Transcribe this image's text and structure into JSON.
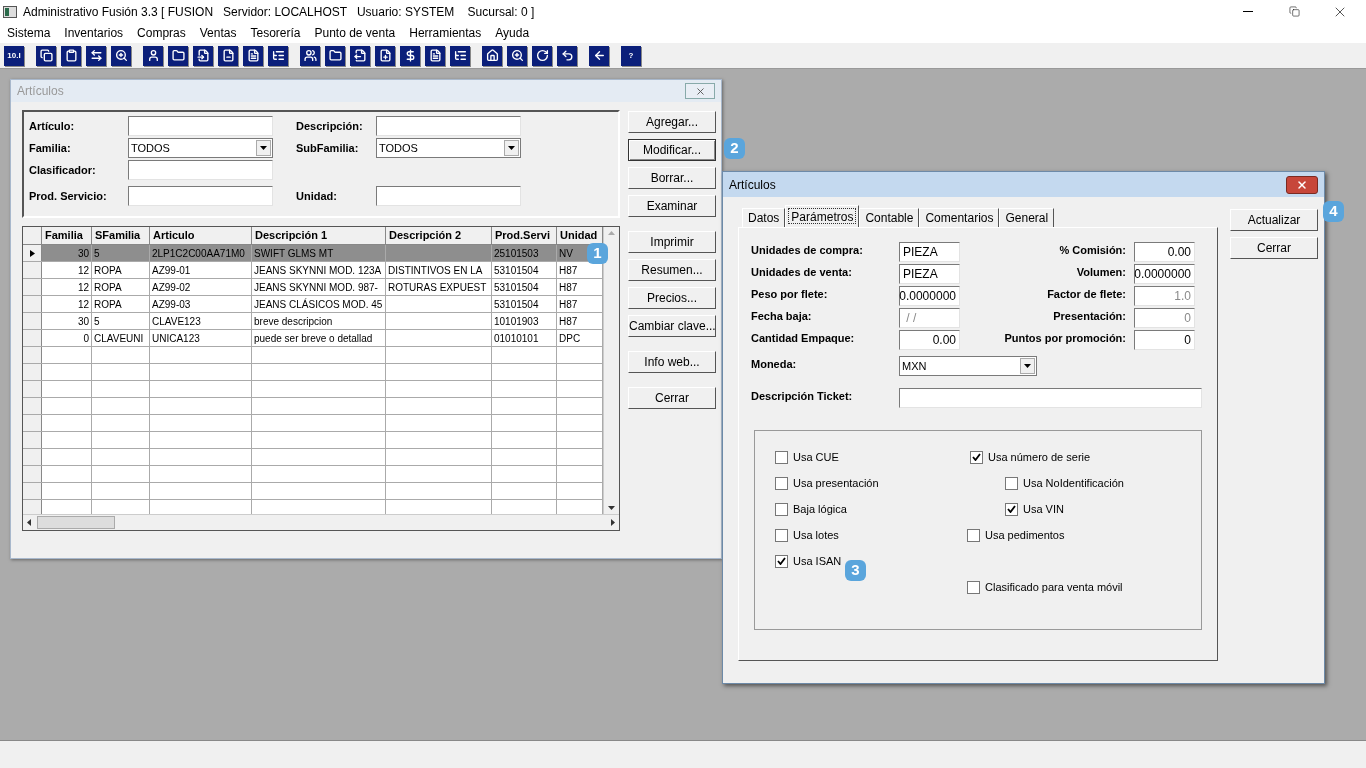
{
  "app": {
    "title": "Administrativo Fusión 3.3 [ FUSION   Servidor: LOCALHOST   Usuario: SYSTEM    Sucursal: 0 ]"
  },
  "menu": [
    "Sistema",
    "Inventarios",
    "Compras",
    "Ventas",
    "Tesorería",
    "Punto de venta",
    "Herramientas",
    "Ayuda"
  ],
  "toolbar_texts": [
    "10.I",
    "?"
  ],
  "list_window": {
    "title": "Artículos",
    "active": false,
    "filter_rows": [
      {
        "left": {
          "label": "Artículo:",
          "kind": "text"
        },
        "right": {
          "label": "Descripción:",
          "kind": "text"
        }
      },
      {
        "left": {
          "label": "Familia:",
          "kind": "combo",
          "value": "TODOS"
        },
        "right": {
          "label": "SubFamilia:",
          "kind": "combo",
          "value": "TODOS"
        }
      },
      {
        "left": {
          "label": "Clasificador:",
          "kind": "text"
        }
      },
      {
        "left": {
          "label": "Prod. Servicio:",
          "kind": "text"
        },
        "right": {
          "label": "Unidad:",
          "kind": "text"
        }
      }
    ],
    "button_groups": [
      [
        {
          "label": "Agregar...",
          "focused": false
        },
        {
          "label": "Modificar...",
          "focused": true
        },
        {
          "label": "Borrar...",
          "focused": false
        },
        {
          "label": "Examinar",
          "focused": false
        }
      ],
      [
        {
          "label": "Imprimir",
          "focused": false
        },
        {
          "label": "Resumen...",
          "focused": false
        },
        {
          "label": "Precios...",
          "focused": false
        },
        {
          "label": "Cambiar clave...",
          "focused": false
        }
      ],
      [
        {
          "label": "Info web...",
          "focused": false
        }
      ],
      [
        {
          "label": "Cerrar",
          "focused": false
        }
      ]
    ],
    "grid": {
      "columns": [
        {
          "label": "Familia",
          "kind": "number"
        },
        {
          "label": "SFamilia",
          "kind": "text"
        },
        {
          "label": "Articulo",
          "kind": "text"
        },
        {
          "label": "Descripción 1",
          "kind": "text"
        },
        {
          "label": "Descripción 2",
          "kind": "text"
        },
        {
          "label": "Prod.Servi",
          "kind": "text"
        },
        {
          "label": "Unidad",
          "kind": "text"
        }
      ],
      "rows": [
        {
          "selected": true,
          "cells": [
            "30",
            "5",
            "2LP1C2C00AA71M0",
            "SWIFT GLMS MT",
            "",
            "25101503",
            "NV"
          ]
        },
        {
          "selected": false,
          "cells": [
            "12",
            "ROPA",
            "AZ99-01",
            "JEANS SKYNNI MOD. 123A",
            "DISTINTIVOS EN LA",
            "53101504",
            "H87"
          ]
        },
        {
          "selected": false,
          "cells": [
            "12",
            "ROPA",
            "AZ99-02",
            "JEANS SKYNNI MOD. 987-",
            "ROTURAS EXPUEST",
            "53101504",
            "H87"
          ]
        },
        {
          "selected": false,
          "cells": [
            "12",
            "ROPA",
            "AZ99-03",
            "JEANS CLÁSICOS MOD. 45",
            "",
            "53101504",
            "H87"
          ]
        },
        {
          "selected": false,
          "cells": [
            "30",
            "5",
            "CLAVE123",
            "breve descripcion",
            "",
            "10101903",
            "H87"
          ]
        },
        {
          "selected": false,
          "cells": [
            "0",
            "CLAVEUNI",
            "UNICA123",
            "puede ser breve o detallad",
            "",
            "01010101",
            "DPC"
          ]
        }
      ]
    }
  },
  "edit_window": {
    "title": "Artículos",
    "active": true,
    "tabs": [
      {
        "label": "Datos",
        "selected": false
      },
      {
        "label": "Parámetros",
        "selected": true
      },
      {
        "label": "Contable",
        "selected": false
      },
      {
        "label": "Comentarios",
        "selected": false
      },
      {
        "label": "General",
        "selected": false
      }
    ],
    "field_rows": [
      {
        "left": {
          "label": "Unidades de compra:",
          "value": "PIEZA",
          "kind": "text",
          "disabled": false
        },
        "right": {
          "label": "% Comisión:",
          "value": "0.00",
          "kind": "number",
          "disabled": false
        }
      },
      {
        "left": {
          "label": "Unidades de venta:",
          "value": "PIEZA",
          "kind": "text",
          "disabled": false
        },
        "right": {
          "label": "Volumen:",
          "value": "0.0000000",
          "kind": "number",
          "disabled": false
        }
      },
      {
        "left": {
          "label": "Peso por flete:",
          "value": "0.0000000",
          "kind": "number",
          "disabled": false
        },
        "right": {
          "label": "Factor de flete:",
          "value": "1.0",
          "kind": "number",
          "disabled": true
        }
      },
      {
        "left": {
          "label": "Fecha baja:",
          "value": " / /",
          "kind": "text",
          "disabled": true
        },
        "right": {
          "label": "Presentación:",
          "value": "0",
          "kind": "number",
          "disabled": true
        }
      },
      {
        "left": {
          "label": "Cantidad Empaque:",
          "value": "0.00",
          "kind": "number",
          "disabled": false
        },
        "right": {
          "label": "Puntos por promoción:",
          "value": "0",
          "kind": "number",
          "disabled": false
        }
      }
    ],
    "currency": {
      "label": "Moneda:",
      "value": "MXN"
    },
    "ticket": {
      "label": "Descripción Ticket:"
    },
    "checks_left": [
      {
        "label": "Usa CUE",
        "checked": false
      },
      {
        "label": "Usa presentación",
        "checked": false
      },
      {
        "label": "Baja lógica",
        "checked": false
      },
      {
        "label": "Usa lotes",
        "checked": false
      },
      {
        "label": "Usa ISAN",
        "checked": true
      }
    ],
    "checks_right": [
      {
        "label": "Usa número de serie",
        "checked": true,
        "children": [
          {
            "label": "Usa NoIdentificación",
            "checked": false
          },
          {
            "label": "Usa VIN",
            "checked": true
          }
        ]
      },
      {
        "label": "Usa pedimentos",
        "checked": false
      },
      {
        "label": "Clasificado para venta móvil",
        "checked": false
      }
    ],
    "buttons": [
      "Actualizar",
      "Cerrar"
    ]
  },
  "callouts": [
    "1",
    "2",
    "3",
    "4"
  ]
}
